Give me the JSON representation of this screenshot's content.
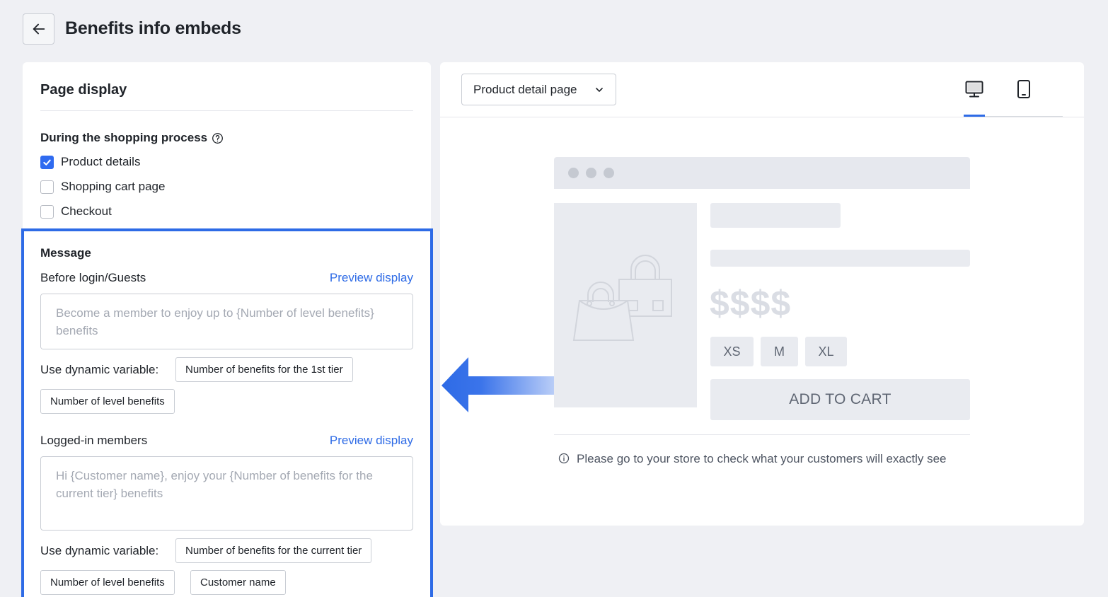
{
  "header": {
    "title": "Benefits info embeds"
  },
  "page_display": {
    "title": "Page display",
    "group_label": "During the shopping process",
    "options": [
      {
        "label": "Product details",
        "checked": true
      },
      {
        "label": "Shopping cart page",
        "checked": false
      },
      {
        "label": "Checkout",
        "checked": false
      }
    ]
  },
  "message": {
    "title": "Message",
    "guests": {
      "label": "Before login/Guests",
      "preview_label": "Preview display",
      "placeholder": "Become a member to enjoy up to {Number of level benefits} benefits",
      "dynamic_label": "Use dynamic variable:",
      "tags": [
        "Number of benefits for the 1st tier",
        "Number of level benefits"
      ]
    },
    "members": {
      "label": "Logged-in members",
      "preview_label": "Preview display",
      "placeholder": "Hi {Customer name}, enjoy your {Number of benefits for the current tier} benefits",
      "dynamic_label": "Use dynamic variable:",
      "tags": [
        "Number of benefits for the current tier",
        "Number of level benefits",
        "Customer name"
      ]
    }
  },
  "preview": {
    "page_select": "Product detail page",
    "device_active": "desktop",
    "mock": {
      "price": "$$$$",
      "sizes": [
        "XS",
        "M",
        "XL"
      ],
      "add_to_cart": "ADD TO CART"
    },
    "note": "Please go to your store to check what your customers will exactly see"
  },
  "colors": {
    "accent": "#2e6be6",
    "background": "#eff0f4"
  }
}
